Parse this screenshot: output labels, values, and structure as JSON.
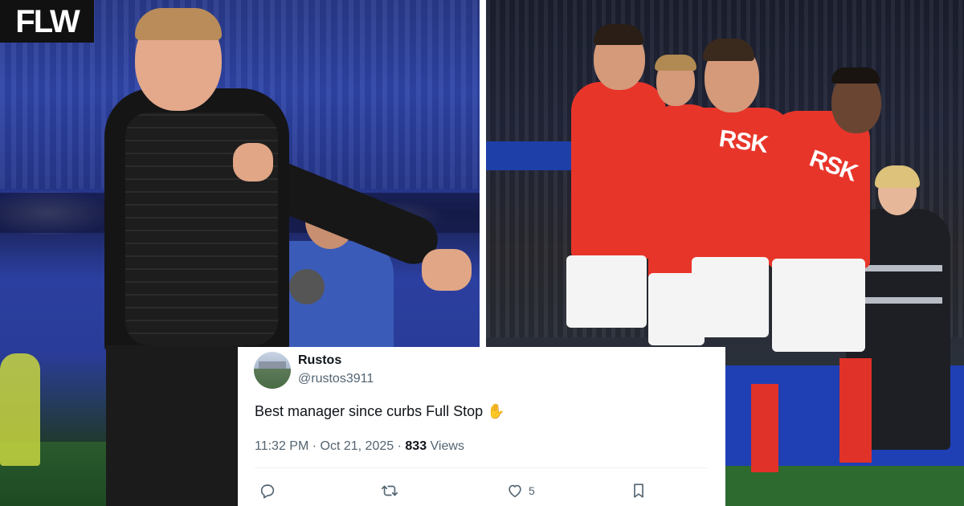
{
  "brand": {
    "logo_text": "FLW"
  },
  "tweet": {
    "display_name": "Rustos",
    "handle": "@rustos3911",
    "text": "Best manager since curbs Full Stop ✋",
    "time": "11:32 PM",
    "separator": "·",
    "date": "Oct 21, 2025",
    "views_count": "833",
    "views_label": "Views",
    "like_count": "5"
  },
  "photo_right": {
    "banner_text": "",
    "sponsor_text": "RSK"
  },
  "icons": {
    "reply": "reply-icon",
    "retweet": "retweet-icon",
    "like": "heart-icon",
    "bookmark": "bookmark-icon"
  },
  "colors": {
    "logo_bg": "#111111",
    "shirt_red": "#e8352a",
    "tweet_text": "#0f1419",
    "tweet_secondary": "#536471"
  }
}
